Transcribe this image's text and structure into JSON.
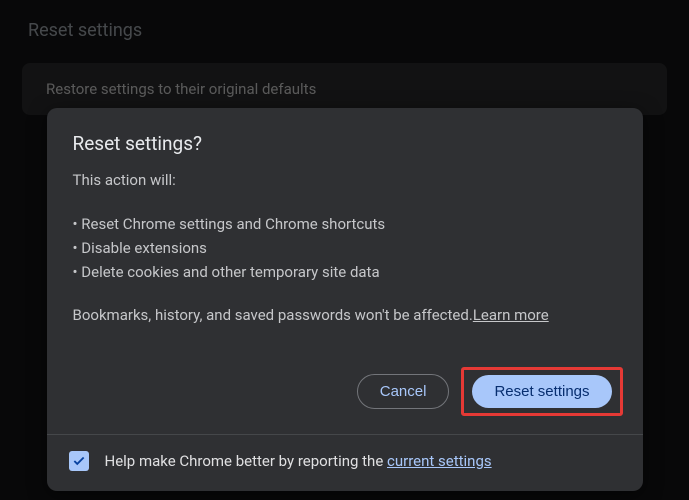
{
  "background": {
    "page_title": "Reset settings",
    "card_text": "Restore settings to their original defaults"
  },
  "dialog": {
    "title": "Reset settings?",
    "lead": "This action will:",
    "bullets": [
      "• Reset Chrome settings and Chrome shortcuts",
      "• Disable extensions",
      "• Delete cookies and other temporary site data"
    ],
    "note_prefix": "Bookmarks, history, and saved passwords won't be affected.",
    "learn_more": "Learn more",
    "cancel_label": "Cancel",
    "reset_label": "Reset settings",
    "footer_prefix": "Help make Chrome better by reporting the ",
    "footer_link": "current settings",
    "checkbox_checked": true
  }
}
